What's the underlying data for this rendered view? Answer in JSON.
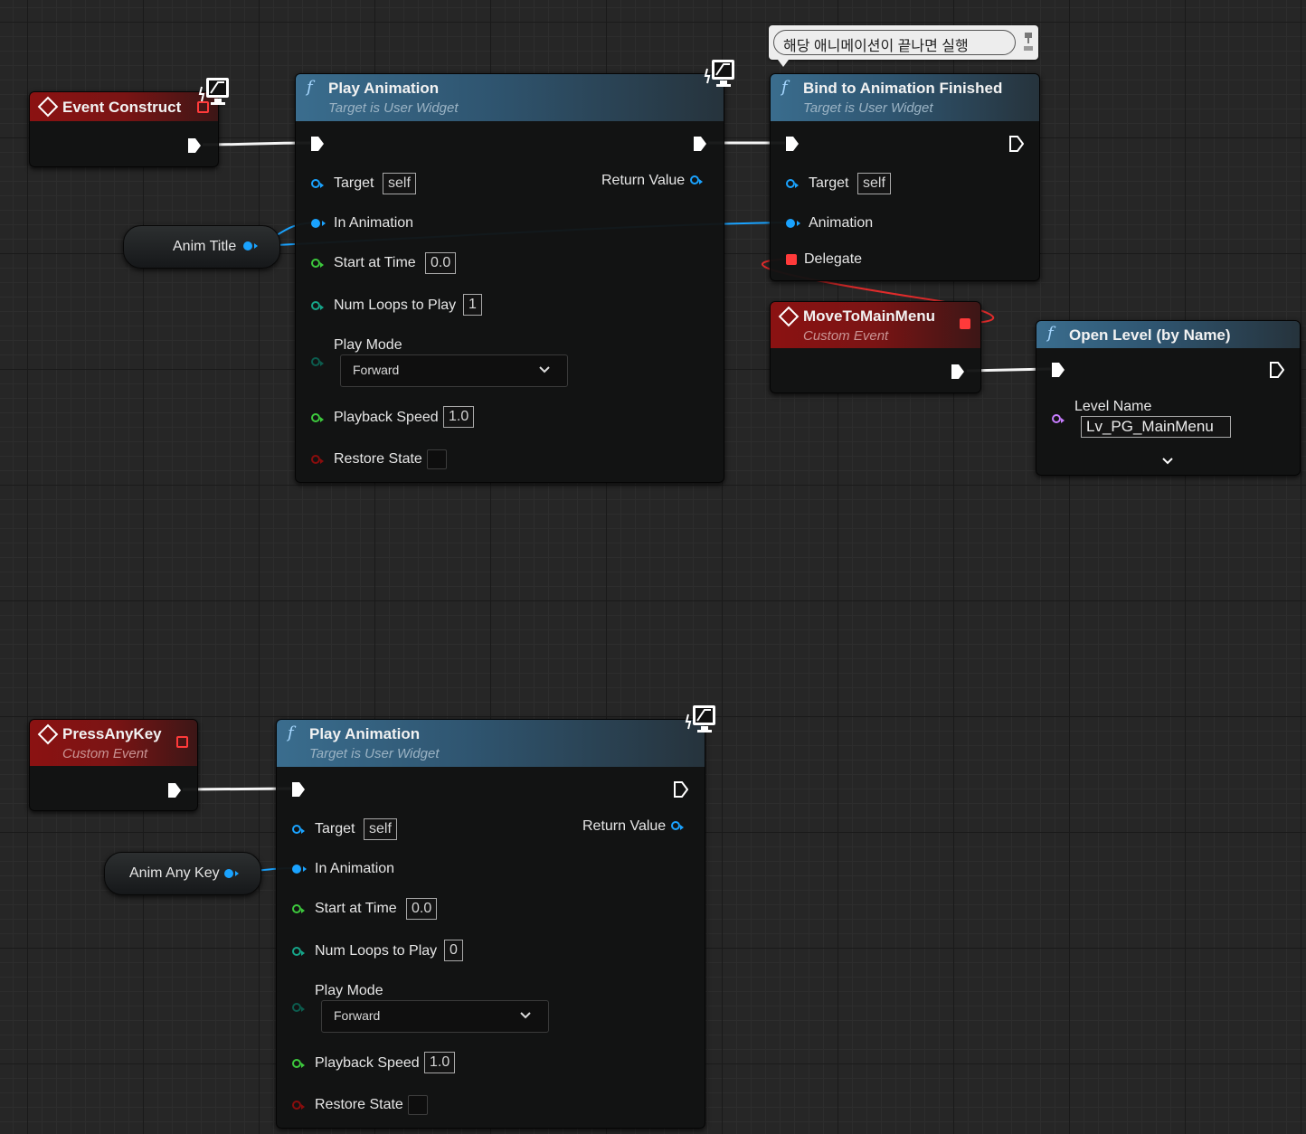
{
  "comment": {
    "text": "해당 애니메이션이 끝나면 실행"
  },
  "event_construct": {
    "title": "Event Construct"
  },
  "play_anim_1": {
    "title": "Play Animation",
    "subtitle": "Target is User Widget",
    "target_label": "Target",
    "target_value": "self",
    "return_label": "Return Value",
    "in_anim_label": "In Animation",
    "start_label": "Start at Time",
    "start_value": "0.0",
    "loops_label": "Num Loops to Play",
    "loops_value": "1",
    "mode_label": "Play Mode",
    "mode_value": "Forward",
    "speed_label": "Playback Speed",
    "speed_value": "1.0",
    "restore_label": "Restore State"
  },
  "anim_title": {
    "label": "Anim Title"
  },
  "bind_finished": {
    "title": "Bind to Animation Finished",
    "subtitle": "Target is User Widget",
    "target_label": "Target",
    "target_value": "self",
    "animation_label": "Animation",
    "delegate_label": "Delegate"
  },
  "move_to_main": {
    "title": "MoveToMainMenu",
    "subtitle": "Custom Event"
  },
  "open_level": {
    "title": "Open Level (by Name)",
    "level_label": "Level Name",
    "level_value": "Lv_PG_MainMenu"
  },
  "press_any_key": {
    "title": "PressAnyKey",
    "subtitle": "Custom Event"
  },
  "anim_any_key": {
    "label": "Anim Any Key"
  },
  "play_anim_2": {
    "title": "Play Animation",
    "subtitle": "Target is User Widget",
    "target_label": "Target",
    "target_value": "self",
    "return_label": "Return Value",
    "in_anim_label": "In Animation",
    "start_label": "Start at Time",
    "start_value": "0.0",
    "loops_label": "Num Loops to Play",
    "loops_value": "0",
    "mode_label": "Play Mode",
    "mode_value": "Forward",
    "speed_label": "Playback Speed",
    "speed_value": "1.0",
    "restore_label": "Restore State"
  },
  "colors": {
    "exec": "#ffffff",
    "object_pin": "#1aa3ff",
    "float_pin": "#3dc83d",
    "int_pin": "#16a589",
    "bool_pin": "#8a0d0d",
    "delegate_pin": "#ff3a3a",
    "name_pin": "#c77dff",
    "function_header": "#3a6d8e",
    "event_header": "#8b1212"
  },
  "icons": [
    "function-icon",
    "event-diamond-icon",
    "monitor-icon",
    "exec-pin-icon",
    "chevron-down-icon",
    "pin-icon"
  ]
}
